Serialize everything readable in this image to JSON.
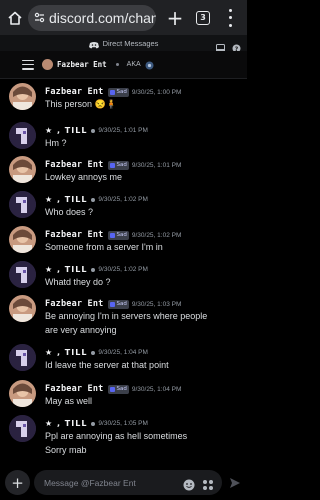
{
  "browser": {
    "url": "discord.com/chann",
    "tab_count": "3"
  },
  "strip": {
    "title": "Direct Messages"
  },
  "header": {
    "name": "Fazbear Ent",
    "aka": "AKA"
  },
  "users": {
    "fazbear": "Fazbear Ent",
    "till": "★ , TILL"
  },
  "tag": "Sad",
  "messages": [
    {
      "author": "Fazbear Ent",
      "tag": "Sad",
      "time": "9/30/25, 1:00 PM",
      "lines": [
        "This person 😒🧍"
      ]
    },
    {
      "author": "★ , TILL",
      "time": "9/30/25, 1:01 PM",
      "lines": [
        "Hm ?"
      ]
    },
    {
      "author": "Fazbear Ent",
      "tag": "Sad",
      "time": "9/30/25, 1:01 PM",
      "lines": [
        "Lowkey annoys me"
      ]
    },
    {
      "author": "★ , TILL",
      "time": "9/30/25, 1:02 PM",
      "lines": [
        "Who does ?"
      ]
    },
    {
      "author": "Fazbear Ent",
      "tag": "Sad",
      "time": "9/30/25, 1:02 PM",
      "lines": [
        "Someone from a server I'm in"
      ]
    },
    {
      "author": "★ , TILL",
      "time": "9/30/25, 1:02 PM",
      "lines": [
        "Whatd they do ?"
      ]
    },
    {
      "author": "Fazbear Ent",
      "tag": "Sad",
      "time": "9/30/25, 1:03 PM",
      "lines": [
        "Be annoying I'm in servers where people",
        "are very annoying"
      ]
    },
    {
      "author": "★ , TILL",
      "time": "9/30/25, 1:04 PM",
      "lines": [
        "Id leave the server at that point"
      ]
    },
    {
      "author": "Fazbear Ent",
      "tag": "Sad",
      "time": "9/30/25, 1:04 PM",
      "lines": [
        "May as well"
      ]
    },
    {
      "author": "★ , TILL",
      "time": "9/30/25, 1:05 PM",
      "lines": [
        "Ppl are annoying as hell sometimes",
        "Sorry mab"
      ]
    }
  ],
  "composer": {
    "placeholder": "Message @Fazbear Ent"
  },
  "colors": {
    "background": "#000000",
    "text": "#dbdee1",
    "timestamp": "#949ba4",
    "tag_bg": "#3b3f4a",
    "blurple": "#5865f2"
  }
}
